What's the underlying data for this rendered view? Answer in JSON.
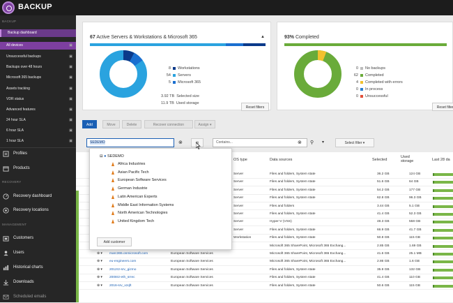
{
  "app": {
    "title": "BACKUP"
  },
  "sidebar": {
    "section_backup": "BACKUP",
    "section_recovery": "RECOVERY",
    "section_management": "MANAGEMENT",
    "items": [
      {
        "label": "Backup dashboard"
      },
      {
        "label": "All devices"
      },
      {
        "label": "Unsuccessful backups"
      },
      {
        "label": "Backups over 48 hours"
      },
      {
        "label": "Microsoft 365 backups"
      },
      {
        "label": "Assets tracking"
      },
      {
        "label": "VDR status"
      },
      {
        "label": "Advanced features"
      },
      {
        "label": "24 hour SLA"
      },
      {
        "label": "6 hour SLA"
      },
      {
        "label": "1 hour SLA"
      }
    ],
    "big_items": [
      {
        "label": "Profiles"
      },
      {
        "label": "Products"
      },
      {
        "label": "Recovery dashboard"
      },
      {
        "label": "Recovery locations"
      },
      {
        "label": "Customers"
      },
      {
        "label": "Users"
      },
      {
        "label": "Historical charts"
      },
      {
        "label": "Downloads"
      },
      {
        "label": "Scheduled emails"
      }
    ]
  },
  "card_left": {
    "count": "67",
    "title": "Active Servers & Workstations & Microsoft 365",
    "legend": [
      {
        "num": "8",
        "label": "Workstations",
        "color": "#0b3a8a"
      },
      {
        "num": "54",
        "label": "Servers",
        "color": "#2aa3df"
      },
      {
        "num": "5",
        "label": "Microsoft 365",
        "color": "#1a6fd0"
      }
    ],
    "size_value": "3.92 TB",
    "size_label": "Selected size",
    "storage_value": "11.9 TB",
    "storage_label": "Used storage",
    "reset_label": "Reset filters"
  },
  "card_right": {
    "percent": "93%",
    "title": "Completed",
    "legend": [
      {
        "num": "0",
        "label": "No backups",
        "color": "#bbbbbb"
      },
      {
        "num": "62",
        "label": "Completed",
        "color": "#6aab3a"
      },
      {
        "num": "4",
        "label": "Completed with errors",
        "color": "#f2c12e"
      },
      {
        "num": "0",
        "label": "In process",
        "color": "#2a7fd0"
      },
      {
        "num": "0",
        "label": "Unsuccessful",
        "color": "#e0503a"
      }
    ],
    "reset_label": "Reset filters"
  },
  "toolbar": {
    "add": "Add",
    "move": "Move",
    "delete": "Delete",
    "recover": "Recover connection",
    "assign": "Assign ▾",
    "search_value": "SEDEMO",
    "contains_placeholder": "Contains...",
    "select_filter": "Select filter"
  },
  "dropdown": {
    "root": "SEDEMO",
    "items": [
      "Africa Industries",
      "Asian Pacific Tech",
      "European Software Services",
      "German Industrie",
      "Latin American Experts",
      "Middle East Information Systems",
      "North American Technologies",
      "United Kingdom Tech"
    ],
    "add_customer": "Add customer"
  },
  "table": {
    "headers": {
      "os_type": "OS type",
      "data_sources": "Data sources",
      "selected": "Selected",
      "used_storage": "Used storage",
      "last28": "Last 28 da"
    },
    "rows": [
      {
        "name": "",
        "customer": "",
        "os": "Server",
        "sources": "Files and folders, System state",
        "selected": "36.2 GB",
        "used": "124 GB"
      },
      {
        "name": "",
        "customer": "",
        "os": "Server",
        "sources": "Files and folders, System state",
        "selected": "51.6 GB",
        "used": "64 GB"
      },
      {
        "name": "",
        "customer": "",
        "os": "Server",
        "sources": "Files and folders, System state",
        "selected": "54.2 GB",
        "used": "177 GB"
      },
      {
        "name": "",
        "customer": "",
        "os": "Server",
        "sources": "Files and folders, System state",
        "selected": "62.8 GB",
        "used": "96.3 GB"
      },
      {
        "name": "",
        "customer": "",
        "os": "Server",
        "sources": "Files and folders",
        "selected": "3.44 GB",
        "used": "5.1 GB"
      },
      {
        "name": "",
        "customer": "",
        "os": "Server",
        "sources": "Files and folders, System state",
        "selected": "41.4 GB",
        "used": "52.3 GB"
      },
      {
        "name": "",
        "customer": "",
        "os": "Server",
        "sources": "Hyper-V (VSS)",
        "selected": "48.3 GB",
        "used": "558 GB"
      },
      {
        "name": "",
        "customer": "",
        "os": "Server",
        "sources": "Files and folders, System state",
        "selected": "66.9 GB",
        "used": "41.7 GB"
      },
      {
        "name": "",
        "customer": "",
        "os": "Workstation",
        "sources": "Files and folders, System state",
        "selected": "50.8 GB",
        "used": "115 GB"
      },
      {
        "name": "c365sedemo",
        "customer": "European Software Services",
        "os": "",
        "sources": "Microsoft 365 SharePoint, Microsoft 365 Exchang...",
        "selected": "2.85 GB",
        "used": "1.69 GB"
      },
      {
        "name": "marc365.onmicrosoft.com",
        "customer": "European Software Services",
        "os": "",
        "sources": "Microsoft 365 SharePoint, Microsoft 365 Exchang...",
        "selected": "41.6 GB",
        "used": "25.1 MB"
      },
      {
        "name": "eu-engineers.com",
        "customer": "European Software Services",
        "os": "",
        "sources": "Microsoft 365 SharePoint, Microsoft 365 Exchang...",
        "selected": "2.86 GB",
        "used": "1.6 GB"
      },
      {
        "name": "2012r2-srv_gizmo",
        "customer": "European Software Services",
        "os": "",
        "sources": "Files and folders, System state",
        "selected": "35.9 GB",
        "used": "132 GB"
      },
      {
        "name": "2008r2-eth_srrec",
        "customer": "European Software Services",
        "os": "",
        "sources": "Files and folders, System state",
        "selected": "41.4 GB",
        "used": "110 GB"
      },
      {
        "name": "2016-srv_xzqft",
        "customer": "European Software Services",
        "os": "",
        "sources": "Files and folders, System state",
        "selected": "50.6 GB",
        "used": "115 GB"
      }
    ]
  }
}
